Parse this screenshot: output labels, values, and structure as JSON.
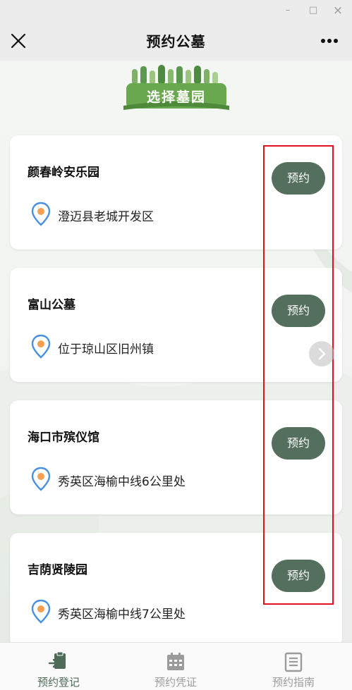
{
  "window": {
    "minimize_glyph": "–",
    "maximize_glyph": "□",
    "close_glyph": "×"
  },
  "navbar": {
    "title": "预约公墓",
    "close_icon": "close-icon",
    "more_icon": "more-icon"
  },
  "banner": {
    "text": "选择墓园"
  },
  "colors": {
    "accent": "#546f5e",
    "highlight_box": "#e0141e",
    "pin_outer": "#4a90e2",
    "pin_inner": "#f5a051"
  },
  "cemeteries": [
    {
      "name": "颜春岭安乐园",
      "address": "澄迈县老城开发区",
      "button": "预约"
    },
    {
      "name": "富山公墓",
      "address": "位于琼山区旧州镇",
      "button": "预约"
    },
    {
      "name": "海口市殡仪馆",
      "address": "秀英区海榆中线6公里处",
      "button": "预约"
    },
    {
      "name": "吉荫贤陵园",
      "address": "秀英区海榆中线7公里处",
      "button": "预约"
    }
  ],
  "tabs": [
    {
      "label": "预约登记",
      "icon": "register-icon",
      "active": true
    },
    {
      "label": "预约凭证",
      "icon": "calendar-icon",
      "active": false
    },
    {
      "label": "预约指南",
      "icon": "guide-icon",
      "active": false
    }
  ]
}
